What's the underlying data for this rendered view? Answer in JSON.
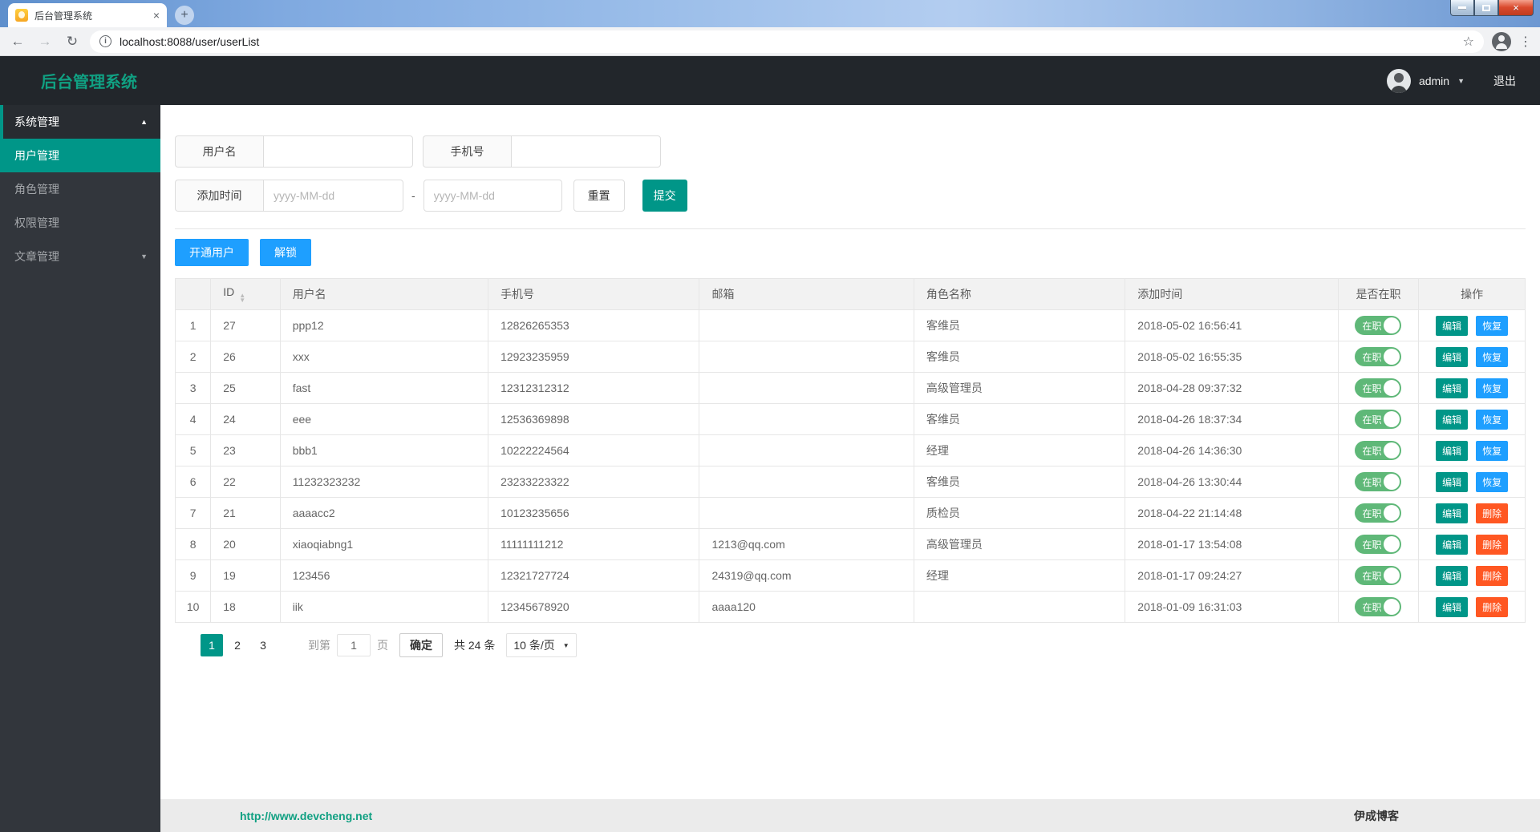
{
  "colors": {
    "accent": "#009688",
    "blue": "#1E9FFF",
    "red": "#FF5722",
    "green": "#5FB878",
    "brand": "#10A082"
  },
  "browser": {
    "tab": {
      "title": "后台管理系统"
    },
    "url": "localhost:8088/user/userList"
  },
  "icons": {
    "back": "←",
    "forward": "→",
    "refresh": "↻",
    "star": "☆",
    "menu": "⋮",
    "close": "×",
    "new_tab": "+",
    "caret_up": "▲",
    "caret_down": "▼",
    "sort_asc": "▲",
    "sort_desc": "▼",
    "prev": "‹",
    "next": "›"
  },
  "header": {
    "logo": "后台管理系统",
    "username": "admin",
    "logout": "退出"
  },
  "sidebar": {
    "items": [
      {
        "label": "系统管理"
      },
      {
        "label": "用户管理"
      },
      {
        "label": "角色管理"
      },
      {
        "label": "权限管理"
      },
      {
        "label": "文章管理"
      }
    ]
  },
  "filters": {
    "username_label": "用户名",
    "phone_label": "手机号",
    "addtime_label": "添加时间",
    "date_placeholder": "yyyy-MM-dd",
    "range_separator": "-",
    "reset_label": "重置",
    "submit_label": "提交"
  },
  "batch": {
    "open_user": "开通用户",
    "unlock": "解锁"
  },
  "table": {
    "headers": [
      "",
      "ID",
      "用户名",
      "手机号",
      "邮箱",
      "角色名称",
      "添加时间",
      "是否在职",
      "操作"
    ],
    "toggle_on_label": "在职",
    "edit_label": "编辑",
    "restore_label": "恢复",
    "delete_label": "删除",
    "rows": [
      {
        "seq": "1",
        "id": "27",
        "username": "ppp12",
        "phone": "12826265353",
        "email": "",
        "role": "客维员",
        "time": "2018-05-02 16:56:41",
        "employed": true,
        "action2": "restore"
      },
      {
        "seq": "2",
        "id": "26",
        "username": "xxx",
        "phone": "12923235959",
        "email": "",
        "role": "客维员",
        "time": "2018-05-02 16:55:35",
        "employed": true,
        "action2": "restore"
      },
      {
        "seq": "3",
        "id": "25",
        "username": "fast",
        "phone": "12312312312",
        "email": "",
        "role": "高级管理员",
        "time": "2018-04-28 09:37:32",
        "employed": true,
        "action2": "restore"
      },
      {
        "seq": "4",
        "id": "24",
        "username": "eee",
        "phone": "12536369898",
        "email": "",
        "role": "客维员",
        "time": "2018-04-26 18:37:34",
        "employed": true,
        "action2": "restore"
      },
      {
        "seq": "5",
        "id": "23",
        "username": "bbb1",
        "phone": "10222224564",
        "email": "",
        "role": "经理",
        "time": "2018-04-26 14:36:30",
        "employed": true,
        "action2": "restore"
      },
      {
        "seq": "6",
        "id": "22",
        "username": "11232323232",
        "phone": "23233223322",
        "email": "",
        "role": "客维员",
        "time": "2018-04-26 13:30:44",
        "employed": true,
        "action2": "restore"
      },
      {
        "seq": "7",
        "id": "21",
        "username": "aaaacc2",
        "phone": "10123235656",
        "email": "",
        "role": "质检员",
        "time": "2018-04-22 21:14:48",
        "employed": true,
        "action2": "delete"
      },
      {
        "seq": "8",
        "id": "20",
        "username": "xiaoqiabng1",
        "phone": "11111111212",
        "email": "1213@qq.com",
        "role": "高级管理员",
        "time": "2018-01-17 13:54:08",
        "employed": true,
        "action2": "delete"
      },
      {
        "seq": "9",
        "id": "19",
        "username": "123456",
        "phone": "12321727724",
        "email": "24319@qq.com",
        "role": "经理",
        "time": "2018-01-17 09:24:27",
        "employed": true,
        "action2": "delete"
      },
      {
        "seq": "10",
        "id": "18",
        "username": "iik",
        "phone": "12345678920",
        "email": "aaaa120",
        "role": "",
        "time": "2018-01-09 16:31:03",
        "employed": true,
        "action2": "delete"
      }
    ]
  },
  "pagination": {
    "pages": [
      "1",
      "2",
      "3"
    ],
    "active": "1",
    "goto_prefix": "到第",
    "goto_value": "1",
    "goto_suffix": "页",
    "confirm_label": "确定",
    "total_label": "共 24 条",
    "page_size": "10 条/页"
  },
  "footer": {
    "link": "http://www.devcheng.net",
    "brand": "伊成博客"
  }
}
